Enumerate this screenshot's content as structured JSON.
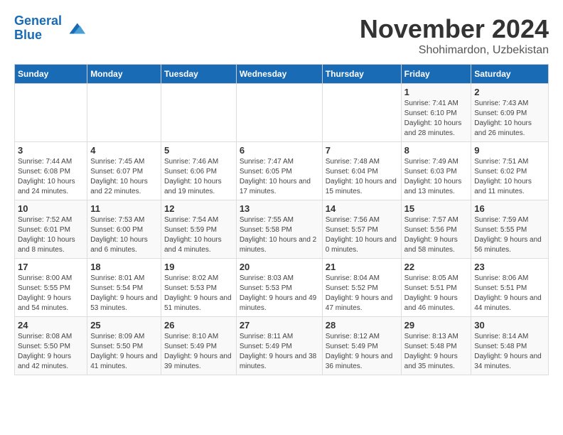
{
  "logo": {
    "line1": "General",
    "line2": "Blue"
  },
  "title": "November 2024",
  "location": "Shohimardon, Uzbekistan",
  "headers": [
    "Sunday",
    "Monday",
    "Tuesday",
    "Wednesday",
    "Thursday",
    "Friday",
    "Saturday"
  ],
  "weeks": [
    [
      {
        "day": "",
        "info": ""
      },
      {
        "day": "",
        "info": ""
      },
      {
        "day": "",
        "info": ""
      },
      {
        "day": "",
        "info": ""
      },
      {
        "day": "",
        "info": ""
      },
      {
        "day": "1",
        "info": "Sunrise: 7:41 AM\nSunset: 6:10 PM\nDaylight: 10 hours and 28 minutes."
      },
      {
        "day": "2",
        "info": "Sunrise: 7:43 AM\nSunset: 6:09 PM\nDaylight: 10 hours and 26 minutes."
      }
    ],
    [
      {
        "day": "3",
        "info": "Sunrise: 7:44 AM\nSunset: 6:08 PM\nDaylight: 10 hours and 24 minutes."
      },
      {
        "day": "4",
        "info": "Sunrise: 7:45 AM\nSunset: 6:07 PM\nDaylight: 10 hours and 22 minutes."
      },
      {
        "day": "5",
        "info": "Sunrise: 7:46 AM\nSunset: 6:06 PM\nDaylight: 10 hours and 19 minutes."
      },
      {
        "day": "6",
        "info": "Sunrise: 7:47 AM\nSunset: 6:05 PM\nDaylight: 10 hours and 17 minutes."
      },
      {
        "day": "7",
        "info": "Sunrise: 7:48 AM\nSunset: 6:04 PM\nDaylight: 10 hours and 15 minutes."
      },
      {
        "day": "8",
        "info": "Sunrise: 7:49 AM\nSunset: 6:03 PM\nDaylight: 10 hours and 13 minutes."
      },
      {
        "day": "9",
        "info": "Sunrise: 7:51 AM\nSunset: 6:02 PM\nDaylight: 10 hours and 11 minutes."
      }
    ],
    [
      {
        "day": "10",
        "info": "Sunrise: 7:52 AM\nSunset: 6:01 PM\nDaylight: 10 hours and 8 minutes."
      },
      {
        "day": "11",
        "info": "Sunrise: 7:53 AM\nSunset: 6:00 PM\nDaylight: 10 hours and 6 minutes."
      },
      {
        "day": "12",
        "info": "Sunrise: 7:54 AM\nSunset: 5:59 PM\nDaylight: 10 hours and 4 minutes."
      },
      {
        "day": "13",
        "info": "Sunrise: 7:55 AM\nSunset: 5:58 PM\nDaylight: 10 hours and 2 minutes."
      },
      {
        "day": "14",
        "info": "Sunrise: 7:56 AM\nSunset: 5:57 PM\nDaylight: 10 hours and 0 minutes."
      },
      {
        "day": "15",
        "info": "Sunrise: 7:57 AM\nSunset: 5:56 PM\nDaylight: 9 hours and 58 minutes."
      },
      {
        "day": "16",
        "info": "Sunrise: 7:59 AM\nSunset: 5:55 PM\nDaylight: 9 hours and 56 minutes."
      }
    ],
    [
      {
        "day": "17",
        "info": "Sunrise: 8:00 AM\nSunset: 5:55 PM\nDaylight: 9 hours and 54 minutes."
      },
      {
        "day": "18",
        "info": "Sunrise: 8:01 AM\nSunset: 5:54 PM\nDaylight: 9 hours and 53 minutes."
      },
      {
        "day": "19",
        "info": "Sunrise: 8:02 AM\nSunset: 5:53 PM\nDaylight: 9 hours and 51 minutes."
      },
      {
        "day": "20",
        "info": "Sunrise: 8:03 AM\nSunset: 5:53 PM\nDaylight: 9 hours and 49 minutes."
      },
      {
        "day": "21",
        "info": "Sunrise: 8:04 AM\nSunset: 5:52 PM\nDaylight: 9 hours and 47 minutes."
      },
      {
        "day": "22",
        "info": "Sunrise: 8:05 AM\nSunset: 5:51 PM\nDaylight: 9 hours and 46 minutes."
      },
      {
        "day": "23",
        "info": "Sunrise: 8:06 AM\nSunset: 5:51 PM\nDaylight: 9 hours and 44 minutes."
      }
    ],
    [
      {
        "day": "24",
        "info": "Sunrise: 8:08 AM\nSunset: 5:50 PM\nDaylight: 9 hours and 42 minutes."
      },
      {
        "day": "25",
        "info": "Sunrise: 8:09 AM\nSunset: 5:50 PM\nDaylight: 9 hours and 41 minutes."
      },
      {
        "day": "26",
        "info": "Sunrise: 8:10 AM\nSunset: 5:49 PM\nDaylight: 9 hours and 39 minutes."
      },
      {
        "day": "27",
        "info": "Sunrise: 8:11 AM\nSunset: 5:49 PM\nDaylight: 9 hours and 38 minutes."
      },
      {
        "day": "28",
        "info": "Sunrise: 8:12 AM\nSunset: 5:49 PM\nDaylight: 9 hours and 36 minutes."
      },
      {
        "day": "29",
        "info": "Sunrise: 8:13 AM\nSunset: 5:48 PM\nDaylight: 9 hours and 35 minutes."
      },
      {
        "day": "30",
        "info": "Sunrise: 8:14 AM\nSunset: 5:48 PM\nDaylight: 9 hours and 34 minutes."
      }
    ]
  ]
}
